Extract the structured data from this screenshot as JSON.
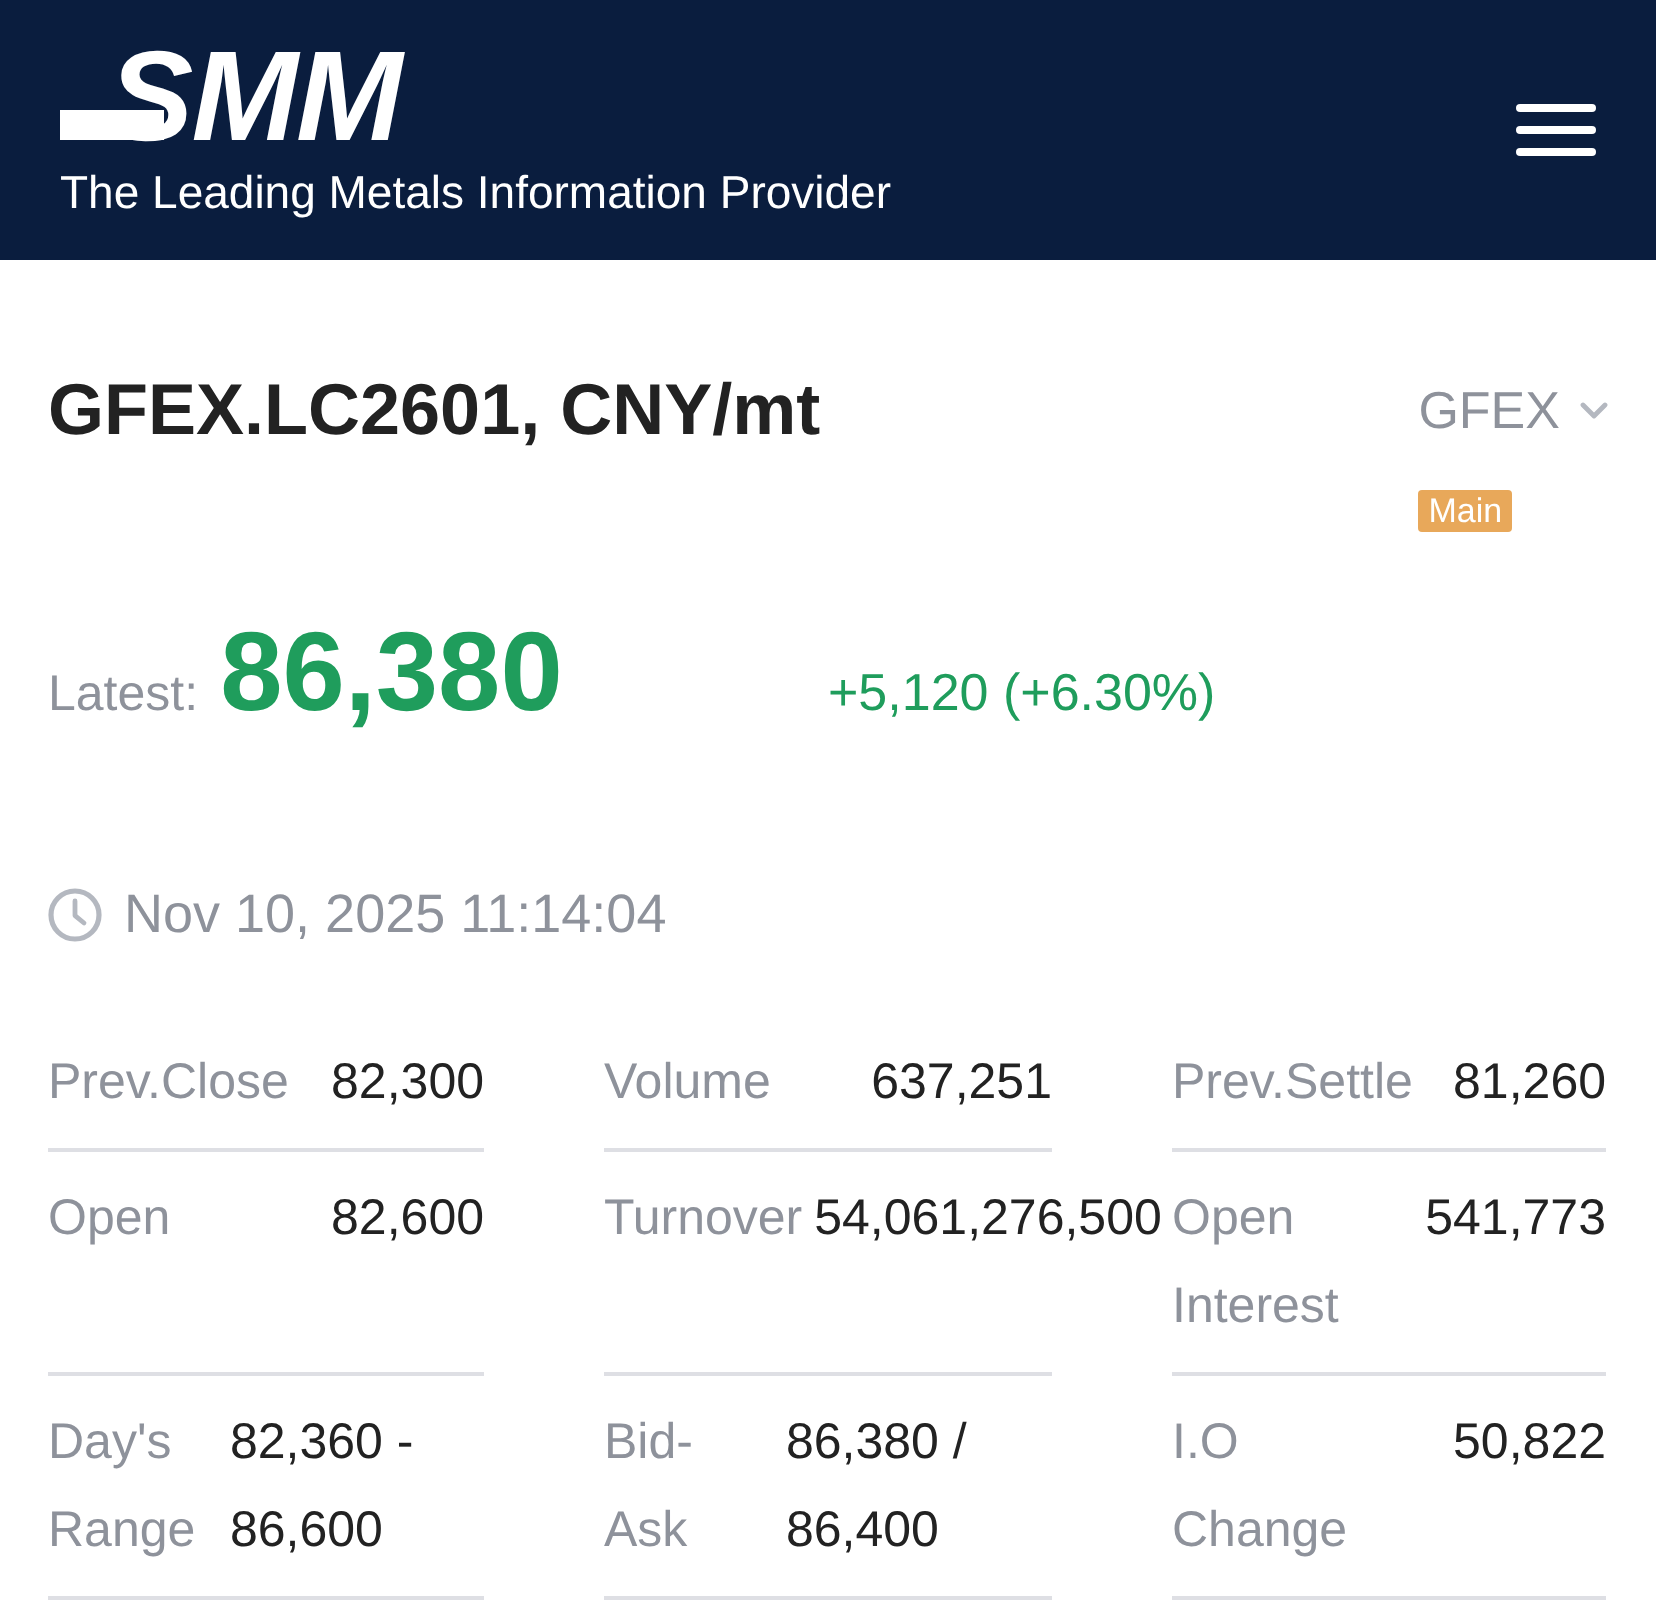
{
  "header": {
    "logo": "SMM",
    "tagline": "The Leading Metals Information Provider"
  },
  "instrument": {
    "title": "GFEX.LC2601, CNY/mt",
    "exchange": "GFEX",
    "tag": "Main"
  },
  "quote": {
    "label": "Latest:",
    "price": "86,380",
    "change": "+5,120 (+6.30%)"
  },
  "timestamp": "Nov 10, 2025 11:14:04",
  "stats": [
    {
      "label": "Prev.Close",
      "value": "82,300"
    },
    {
      "label": "Volume",
      "value": "637,251"
    },
    {
      "label": "Prev.Settle",
      "value": "81,260"
    },
    {
      "label": "Open",
      "value": "82,600"
    },
    {
      "label": "Turnover",
      "value": "54,061,276,500"
    },
    {
      "label": "Open Interest",
      "value": "541,773"
    },
    {
      "label": "Day's Range",
      "value": "82,360 - 86,600"
    },
    {
      "label": "Bid-Ask",
      "value": "86,380 / 86,400"
    },
    {
      "label": "I.O Change",
      "value": "50,822"
    }
  ]
}
